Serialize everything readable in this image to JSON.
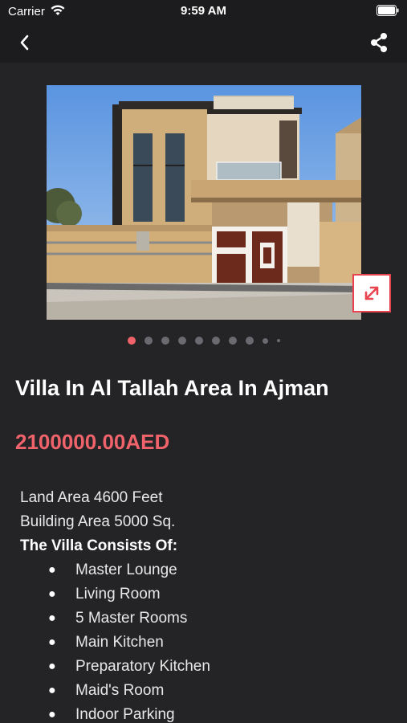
{
  "status_bar": {
    "carrier": "Carrier",
    "time": "9:59 AM",
    "icons": [
      "wifi-icon",
      "battery-icon"
    ]
  },
  "nav": {
    "icons": [
      "chevron-left-icon",
      "share-icon"
    ]
  },
  "gallery": {
    "total_images": 10,
    "current_index": 0,
    "expand_icon": "expand-arrows-icon"
  },
  "listing": {
    "title": "Villa In Al Tallah Area In Ajman",
    "price": "2100000.00AED",
    "description": {
      "land_area": "Land Area 4600 Feet",
      "building_area": "Building Area 5000 Sq.",
      "consists_heading": "The Villa Consists Of:",
      "features": [
        "Master Lounge",
        "Living Room",
        "5 Master Rooms",
        "Main Kitchen",
        "Preparatory Kitchen",
        "Maid's Room",
        "Indoor Parking"
      ]
    }
  },
  "colors": {
    "background": "#242427",
    "bar": "#1c1c1e",
    "accent": "#f0636a",
    "expand_border": "#e8434f"
  }
}
